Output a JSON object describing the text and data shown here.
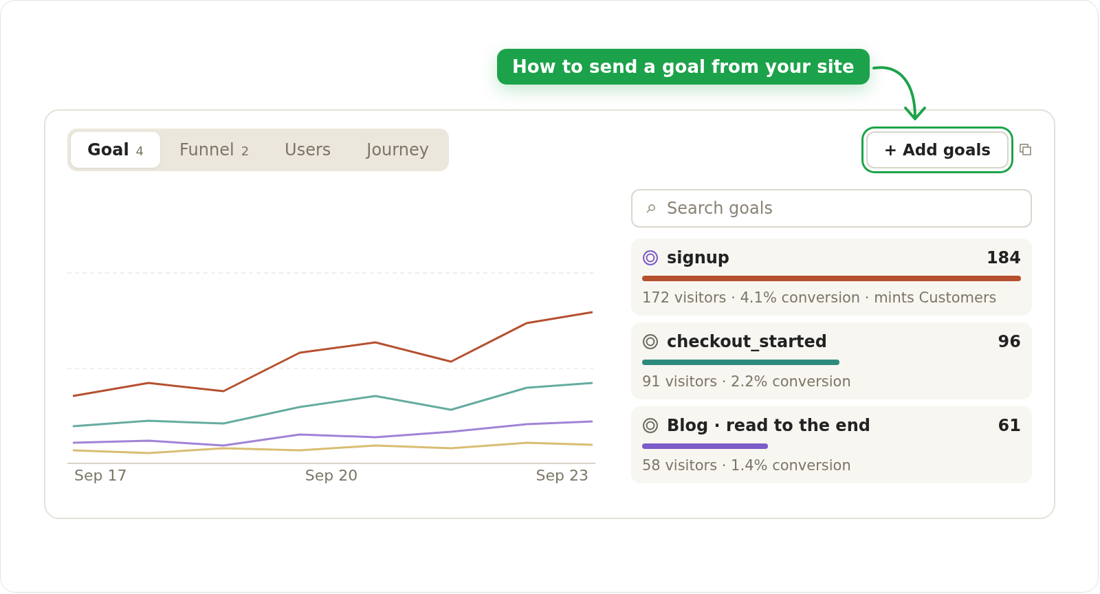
{
  "callout": {
    "text": "How to send a goal from your site"
  },
  "tabs": [
    {
      "label": "Goal",
      "count": "4",
      "selected": true
    },
    {
      "label": "Funnel",
      "count": "2",
      "selected": false
    },
    {
      "label": "Users",
      "selected": false
    },
    {
      "label": "Journey",
      "selected": false
    }
  ],
  "add_button": {
    "label": "+ Add goals",
    "highlighted": true
  },
  "chart": {
    "x_labels": [
      "Sep 17",
      "Sep 20",
      "Sep 23"
    ]
  },
  "search": {
    "placeholder": "Search goals"
  },
  "goals": [
    {
      "name": "signup",
      "count": "184",
      "selected": true,
      "color": "#b5502f",
      "details": "172 visitors · 4.1% conversion · mints Customers"
    },
    {
      "name": "checkout_started",
      "count": "96",
      "selected": false,
      "color": "#2e8a7c",
      "details": "91 visitors · 2.2% conversion"
    },
    {
      "name": "Blog · read to the end",
      "count": "61",
      "selected": false,
      "color": "#7c5cc8",
      "details": "58 visitors · 1.4% conversion"
    }
  ]
}
